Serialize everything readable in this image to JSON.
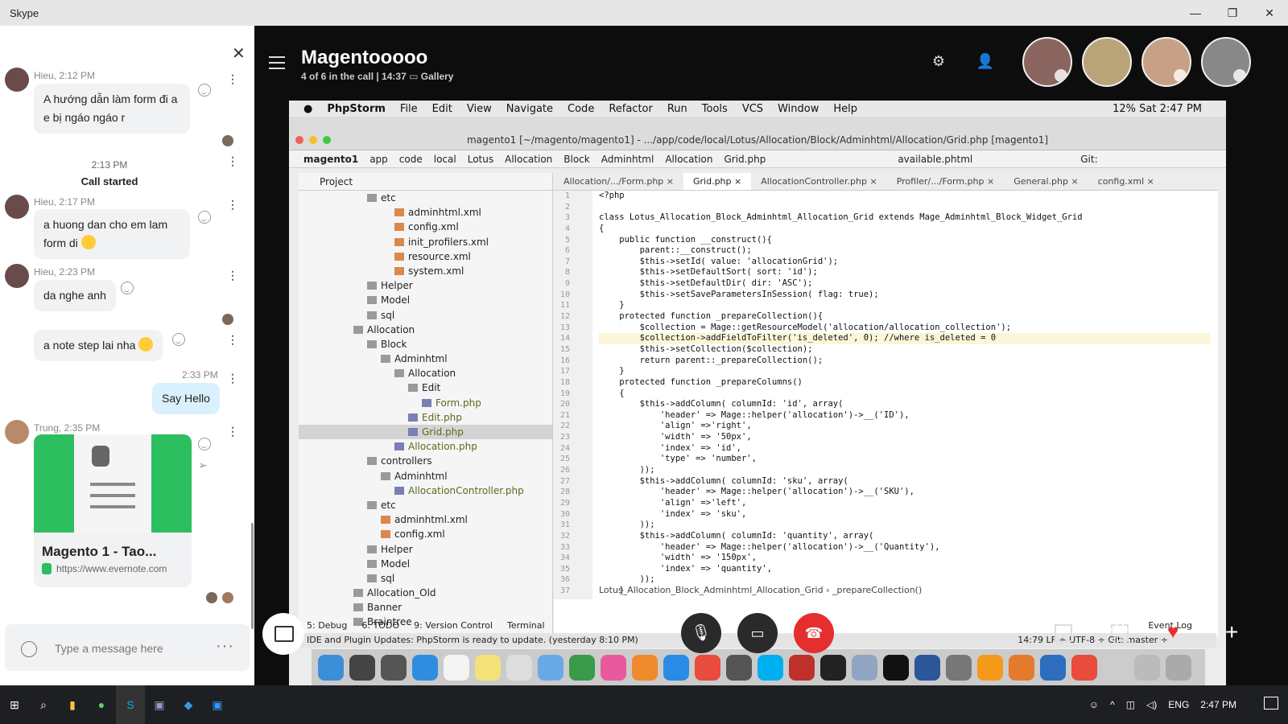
{
  "window": {
    "title": "Skype",
    "controls": [
      "—",
      "❐",
      "✕"
    ]
  },
  "chat": {
    "messages": [
      {
        "sender": "Hieu, 2:12 PM",
        "lines": [
          "A hướng dẫn làm form đi a",
          "e bị ngáo ngáo r"
        ]
      },
      {
        "sender": "Hieu, 2:17 PM",
        "lines": [
          "a huong dan cho em lam",
          "form di"
        ]
      },
      {
        "sender": "Hieu, 2:23 PM",
        "lines": [
          "da nghe anh"
        ]
      },
      {
        "sender": "",
        "lines": [
          "a note step lai nha"
        ]
      },
      {
        "sender": "Trung, 2:35 PM",
        "lines": []
      }
    ],
    "call_time": "2:13 PM",
    "call_started": "Call started",
    "my_time": "2:33 PM",
    "my_message": "Say Hello",
    "card": {
      "title": "Magento 1 - Tao...",
      "url": "https://www.evernote.com"
    },
    "compose_placeholder": "Type a message here",
    "compose_more": "···"
  },
  "call": {
    "title": "Magentooooo",
    "status": "4 of 6 in the call | 14:37",
    "view": "Gallery",
    "participants": 4
  },
  "shared_screen": {
    "menubar": [
      "PhpStorm",
      "File",
      "Edit",
      "View",
      "Navigate",
      "Code",
      "Refactor",
      "Run",
      "Tools",
      "VCS",
      "Window",
      "Help"
    ],
    "menubar_right": "12%   Sat 2:47 PM",
    "ide_title": "magento1 [~/magento/magento1] - .../app/code/local/Lotus/Allocation/Block/Adminhtml/Allocation/Grid.php [magento1]",
    "breadcrumb": [
      "magento1",
      "app",
      "code",
      "local",
      "Lotus",
      "Allocation",
      "Block",
      "Adminhtml",
      "Allocation",
      "Grid.php"
    ],
    "run_config": "available.phtml",
    "git_label": "Git:",
    "project_header": "Project",
    "tree": [
      {
        "name": "etc",
        "indent": 5,
        "type": "folder"
      },
      {
        "name": "adminhtml.xml",
        "indent": 7,
        "type": "xml"
      },
      {
        "name": "config.xml",
        "indent": 7,
        "type": "xml"
      },
      {
        "name": "init_profilers.xml",
        "indent": 7,
        "type": "xml"
      },
      {
        "name": "resource.xml",
        "indent": 7,
        "type": "xml"
      },
      {
        "name": "system.xml",
        "indent": 7,
        "type": "xml"
      },
      {
        "name": "Helper",
        "indent": 5,
        "type": "folder"
      },
      {
        "name": "Model",
        "indent": 5,
        "type": "folder"
      },
      {
        "name": "sql",
        "indent": 5,
        "type": "folder"
      },
      {
        "name": "Allocation",
        "indent": 4,
        "type": "folder"
      },
      {
        "name": "Block",
        "indent": 5,
        "type": "folder"
      },
      {
        "name": "Adminhtml",
        "indent": 6,
        "type": "folder"
      },
      {
        "name": "Allocation",
        "indent": 7,
        "type": "folder"
      },
      {
        "name": "Edit",
        "indent": 8,
        "type": "folder"
      },
      {
        "name": "Form.php",
        "indent": 9,
        "type": "php"
      },
      {
        "name": "Edit.php",
        "indent": 8,
        "type": "php"
      },
      {
        "name": "Grid.php",
        "indent": 8,
        "type": "php-sel"
      },
      {
        "name": "Allocation.php",
        "indent": 7,
        "type": "php"
      },
      {
        "name": "controllers",
        "indent": 5,
        "type": "folder"
      },
      {
        "name": "Adminhtml",
        "indent": 6,
        "type": "folder"
      },
      {
        "name": "AllocationController.php",
        "indent": 7,
        "type": "php"
      },
      {
        "name": "etc",
        "indent": 5,
        "type": "folder"
      },
      {
        "name": "adminhtml.xml",
        "indent": 6,
        "type": "xml"
      },
      {
        "name": "config.xml",
        "indent": 6,
        "type": "xml"
      },
      {
        "name": "Helper",
        "indent": 5,
        "type": "folder"
      },
      {
        "name": "Model",
        "indent": 5,
        "type": "folder"
      },
      {
        "name": "sql",
        "indent": 5,
        "type": "folder"
      },
      {
        "name": "Allocation_Old",
        "indent": 4,
        "type": "folder"
      },
      {
        "name": "Banner",
        "indent": 4,
        "type": "folder"
      },
      {
        "name": "Braintree",
        "indent": 4,
        "type": "folder"
      }
    ],
    "tabs": [
      "Allocation/.../Form.php",
      "Grid.php",
      "AllocationController.php",
      "Profiler/.../Form.php",
      "General.php",
      "config.xml"
    ],
    "code": [
      "<?php",
      "",
      "class Lotus_Allocation_Block_Adminhtml_Allocation_Grid extends Mage_Adminhtml_Block_Widget_Grid",
      "{",
      "    public function __construct(){",
      "        parent::__construct();",
      "        $this->setId( value: 'allocationGrid');",
      "        $this->setDefaultSort( sort: 'id');",
      "        $this->setDefaultDir( dir: 'ASC');",
      "        $this->setSaveParametersInSession( flag: true);",
      "    }",
      "    protected function _prepareCollection(){",
      "        $collection = Mage::getResourceModel('allocation/allocation_collection');",
      "        $collection->addFieldToFilter('is_deleted', 0); //where is_deleted = 0",
      "        $this->setCollection($collection);",
      "        return parent::_prepareCollection();",
      "    }",
      "    protected function _prepareColumns()",
      "    {",
      "        $this->addColumn( columnId: 'id', array(",
      "            'header' => Mage::helper('allocation')->__('ID'),",
      "            'align' =>'right',",
      "            'width' => '50px',",
      "            'index' => 'id',",
      "            'type' => 'number',",
      "        ));",
      "        $this->addColumn( columnId: 'sku', array(",
      "            'header' => Mage::helper('allocation')->__('SKU'),",
      "            'align' =>'left',",
      "            'index' => 'sku',",
      "        ));",
      "        $this->addColumn( columnId: 'quantity', array(",
      "            'header' => Mage::helper('allocation')->__('Quantity'),",
      "            'width' => '150px',",
      "            'index' => 'quantity',",
      "        ));",
      "    }"
    ],
    "code_footer": "Lotus_Allocation_Block_Adminhtml_Allocation_Grid  ›  _prepareCollection()",
    "bottom_tools": [
      "5: Debug",
      "6: TODO",
      "9: Version Control",
      "Terminal"
    ],
    "event_log": "Event Log",
    "status_text": "IDE and Plugin Updates: PhpStorm is ready to update. (yesterday 8:10 PM)",
    "status_right": "14:79   LF ÷   UTF-8 ÷   Git: master ÷"
  },
  "taskbar": {
    "time": "2:47 PM",
    "lang": "ENG"
  }
}
